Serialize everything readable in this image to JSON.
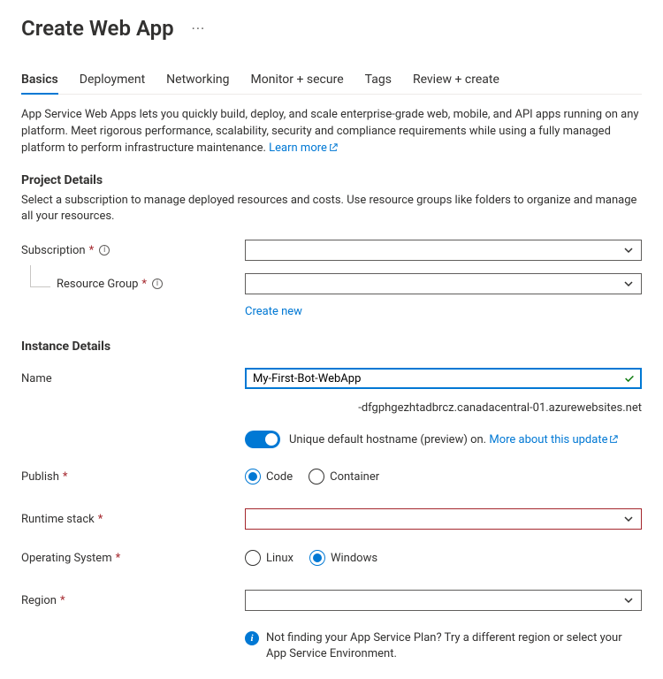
{
  "header": {
    "title": "Create Web App"
  },
  "tabs": {
    "items": [
      {
        "label": "Basics",
        "active": true
      },
      {
        "label": "Deployment",
        "active": false
      },
      {
        "label": "Networking",
        "active": false
      },
      {
        "label": "Monitor + secure",
        "active": false
      },
      {
        "label": "Tags",
        "active": false
      },
      {
        "label": "Review + create",
        "active": false
      }
    ]
  },
  "intro": {
    "text": "App Service Web Apps lets you quickly build, deploy, and scale enterprise-grade web, mobile, and API apps running on any platform. Meet rigorous performance, scalability, security and compliance requirements while using a fully managed platform to perform infrastructure maintenance.  ",
    "learn_more": "Learn more"
  },
  "project": {
    "heading": "Project Details",
    "desc": "Select a subscription to manage deployed resources and costs. Use resource groups like folders to organize and manage all your resources.",
    "subscription_label": "Subscription",
    "subscription_value": "",
    "resource_group_label": "Resource Group",
    "resource_group_value": "",
    "create_new": "Create new"
  },
  "instance": {
    "heading": "Instance Details",
    "name_label": "Name",
    "name_value": "My-First-Bot-WebApp",
    "domain_suffix": "-dfgphgezhtadbrcz.canadacentral-01.azurewebsites.net",
    "toggle_label": "Unique default hostname (preview) on. ",
    "toggle_link": "More about this update",
    "publish_label": "Publish",
    "publish_options": {
      "code": "Code",
      "container": "Container"
    },
    "runtime_label": "Runtime stack",
    "runtime_value": "",
    "os_label": "Operating System",
    "os_options": {
      "linux": "Linux",
      "windows": "Windows"
    },
    "region_label": "Region",
    "region_value": "",
    "region_hint": "Not finding your App Service Plan? Try a different region or select your App Service Environment."
  }
}
